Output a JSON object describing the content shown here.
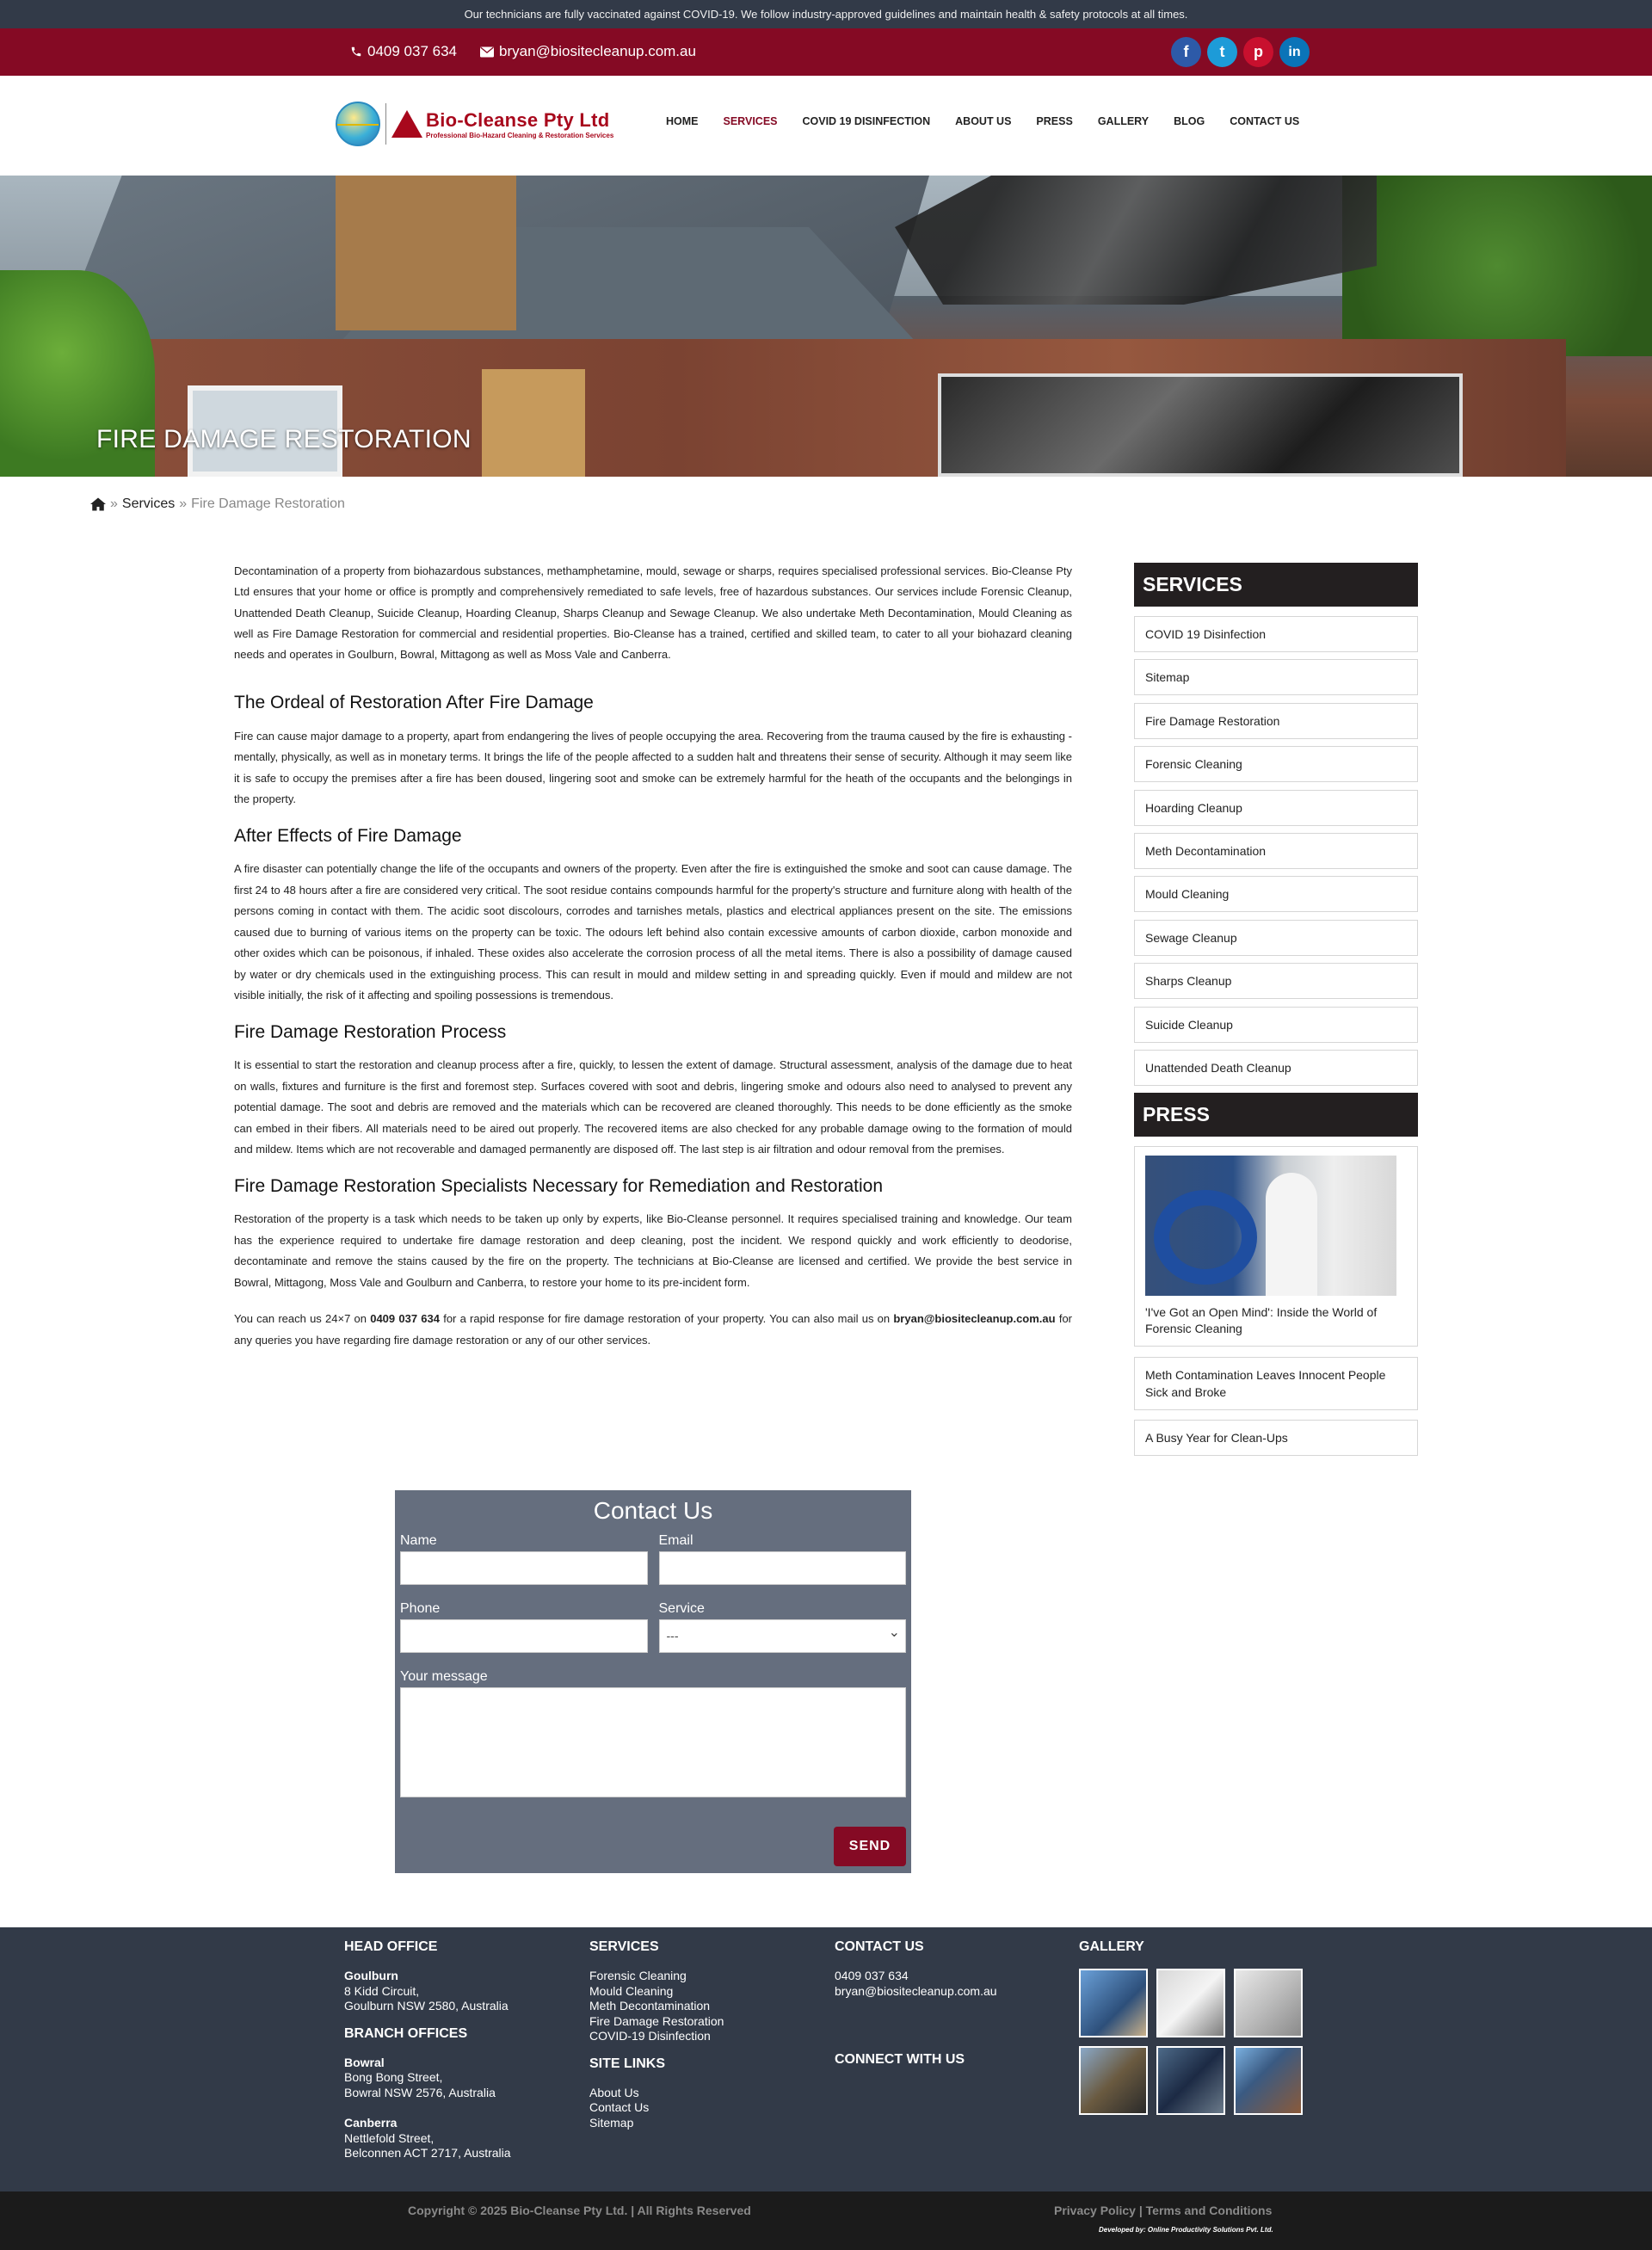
{
  "notice": "Our technicians are fully vaccinated against COVID-19. We follow industry-approved guidelines and maintain health & safety protocols at all times.",
  "contact": {
    "phone": "0409 037 634",
    "email": "bryan@biositecleanup.com.au"
  },
  "socials": [
    {
      "name": "facebook",
      "glyph": "f",
      "color": "#2d5aa8"
    },
    {
      "name": "twitter",
      "glyph": "t",
      "color": "#1d9bd8"
    },
    {
      "name": "pinterest",
      "glyph": "p",
      "color": "#c8102e"
    },
    {
      "name": "linkedin",
      "glyph": "in",
      "color": "#0a74b8"
    }
  ],
  "logo": {
    "name": "Bio-Cleanse Pty Ltd",
    "tagline": "Professional Bio-Hazard Cleaning & Restoration Services"
  },
  "nav": [
    "HOME",
    "SERVICES",
    "COVID 19 DISINFECTION",
    "ABOUT US",
    "PRESS",
    "GALLERY",
    "BLOG",
    "CONTACT US"
  ],
  "hero_title": "FIRE DAMAGE RESTORATION",
  "breadcrumb": {
    "separator": "»",
    "parent": "Services",
    "current": "Fire Damage Restoration"
  },
  "content": {
    "intro": "Decontamination of a property from biohazardous substances, methamphetamine, mould, sewage or sharps, requires specialised professional services. Bio-Cleanse Pty Ltd ensures that your home or office is promptly and comprehensively remediated to safe levels, free of hazardous substances. Our services include Forensic Cleanup, Unattended Death Cleanup, Suicide Cleanup, Hoarding Cleanup, Sharps Cleanup and Sewage Cleanup. We also undertake Meth Decontamination, Mould Cleaning as well as Fire Damage Restoration for commercial and residential properties. Bio-Cleanse has a trained, certified and skilled team, to cater to all your biohazard cleaning needs and operates in Goulburn, Bowral, Mittagong as well as Moss Vale and Canberra.",
    "h1": "The Ordeal of Restoration After Fire Damage",
    "p1": "Fire can cause major damage to a property, apart from endangering the lives of people occupying the area. Recovering from the trauma caused by the fire is exhausting -mentally, physically, as well as in monetary terms. It brings the life of the people affected to a sudden halt and threatens their sense of security. Although it may seem like it is safe to occupy the premises after a fire has been doused, lingering soot and smoke can be extremely harmful for the heath of the occupants and the belongings in the property.",
    "h2": "After Effects of Fire Damage",
    "p2": "A fire disaster can potentially change the life of the occupants and owners of the property. Even after the fire is extinguished the smoke and soot can cause damage. The first 24 to 48 hours after a fire are considered very critical. The soot residue contains compounds harmful for the property's structure and furniture along with health of the persons coming in contact with them. The acidic soot discolours, corrodes and tarnishes metals, plastics and electrical appliances present on the site. The emissions caused due to burning of various items on the property can be toxic. The odours left behind also contain excessive amounts of carbon dioxide, carbon monoxide and other oxides which can be poisonous, if inhaled. These oxides also accelerate the corrosion process of all the metal items. There is also a possibility of damage caused by water or dry chemicals used in the extinguishing process. This can result in mould and mildew setting in and spreading quickly. Even if mould and mildew are not visible initially, the risk of it affecting and spoiling possessions is tremendous.",
    "h3": "Fire Damage Restoration Process",
    "p3": "It is essential to start the restoration and cleanup process after a fire, quickly, to lessen the extent of damage. Structural assessment, analysis of the damage due to heat on walls, fixtures and furniture is the first and foremost step. Surfaces covered with soot and debris, lingering smoke and odours also need to analysed to prevent any potential damage. The soot and debris are removed and the materials which can be recovered are cleaned thoroughly. This needs to be done efficiently as the smoke can embed in their fibers. All materials need to be aired out properly. The recovered items are also checked for any probable damage owing to the formation of mould and mildew. Items which are not recoverable and damaged permanently are disposed off. The last step is air filtration and odour removal from the premises.",
    "h4": "Fire Damage Restoration Specialists Necessary for Remediation and Restoration",
    "p4": "Restoration of the property is a task which needs to be taken up only by experts, like Bio-Cleanse personnel. It requires specialised training and knowledge. Our team has the experience required to undertake fire damage restoration and deep cleaning, post the incident. We respond quickly and work efficiently to deodorise, decontaminate and remove the stains caused by the fire on the property. The technicians at Bio-Cleanse are licensed and certified. We provide the best service in Bowral, Mittagong, Moss Vale and Goulburn and Canberra, to restore your home to its pre-incident form.",
    "p5a": "You can reach us 24×7 on",
    "p5phone": "0409 037 634",
    "p5b": "for a rapid response for fire damage restoration of your property. You can also mail us on",
    "p5email": "bryan@biositecleanup.com.au",
    "p5c": "for any queries you have regarding fire damage restoration or any of our other services."
  },
  "sidebar": {
    "services_title": "SERVICES",
    "services": [
      "COVID 19 Disinfection",
      "Sitemap",
      "Fire Damage Restoration",
      "Forensic Cleaning",
      "Hoarding Cleanup",
      "Meth Decontamination",
      "Mould Cleaning",
      "Sewage Cleanup",
      "Sharps Cleanup",
      "Suicide Cleanup",
      "Unattended Death Cleanup"
    ],
    "press_title": "PRESS",
    "press": [
      "'I've Got an Open Mind': Inside the World of Forensic Cleaning",
      "Meth Contamination Leaves Innocent People Sick and Broke",
      "A Busy Year for Clean-Ups"
    ]
  },
  "form": {
    "title": "Contact Us",
    "name_label": "Name",
    "email_label": "Email",
    "phone_label": "Phone",
    "service_label": "Service",
    "service_value": "---",
    "message_label": "Your message",
    "send": "SEND"
  },
  "footer": {
    "head_office_title": "HEAD OFFICE",
    "head_office": {
      "city": "Goulburn",
      "line1": "8 Kidd Circuit,",
      "line2": "Goulburn NSW 2580, Australia"
    },
    "branch_title": "BRANCH OFFICES",
    "branch1": {
      "city": "Bowral",
      "line1": "Bong Bong Street,",
      "line2": "Bowral NSW 2576, Australia"
    },
    "branch2": {
      "city": "Canberra",
      "line1": "Nettlefold Street,",
      "line2": "Belconnen ACT 2717, Australia"
    },
    "services_title": "SERVICES",
    "services": [
      "Forensic Cleaning",
      "Mould Cleaning",
      "Meth Decontamination",
      "Fire Damage Restoration",
      "COVID-19 Disinfection"
    ],
    "sitelinks_title": "SITE LINKS",
    "sitelinks": [
      "About Us",
      "Contact Us",
      "Sitemap"
    ],
    "contact_title": "CONTACT US",
    "phone": "0409 037 634",
    "email": "bryan@biositecleanup.com.au",
    "connect_title": "CONNECT WITH US",
    "gallery_title": "GALLERY",
    "copyright": "Copyright © 2025 Bio-Cleanse Pty Ltd. | All Rights Reserved",
    "legal": "Privacy Policy | Terms and Conditions",
    "developer": "Developed by: Online Productivity Solutions Pvt. Ltd."
  }
}
